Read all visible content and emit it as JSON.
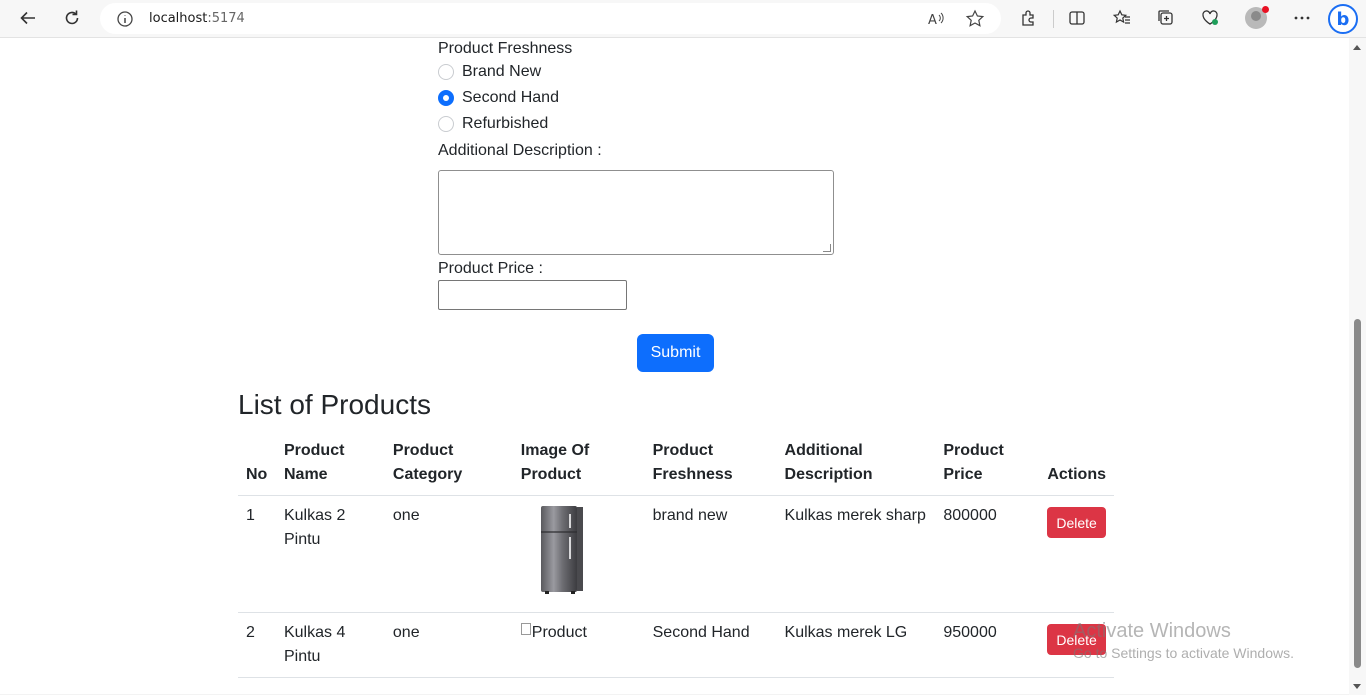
{
  "browser": {
    "url_host": "localhost",
    "url_port": ":5174"
  },
  "form": {
    "freshness_label": "Product Freshness",
    "freshness_options": [
      {
        "label": "Brand New",
        "checked": false
      },
      {
        "label": "Second Hand",
        "checked": true
      },
      {
        "label": "Refurbished",
        "checked": false
      }
    ],
    "description_label": "Additional Description :",
    "description_value": "",
    "price_label": "Product Price :",
    "price_value": "",
    "submit_label": "Submit"
  },
  "products": {
    "title": "List of Products",
    "columns": [
      "No",
      "Product Name",
      "Product Category",
      "Image Of Product",
      "Product Freshness",
      "Additional Description",
      "Product Price",
      "Actions"
    ],
    "rows": [
      {
        "no": "1",
        "name": "Kulkas 2 Pintu",
        "category": "one",
        "image": "fridge",
        "freshness": "brand new",
        "description": "Kulkas merek sharp",
        "price": "800000",
        "action": "Delete"
      },
      {
        "no": "2",
        "name": "Kulkas 4 Pintu",
        "category": "one",
        "image_alt": "Product",
        "freshness": "Second Hand",
        "description": "Kulkas merek LG",
        "price": "950000",
        "action": "Delete"
      }
    ]
  },
  "watermark": {
    "line1": "Activate Windows",
    "line2": "Go to Settings to activate Windows."
  }
}
